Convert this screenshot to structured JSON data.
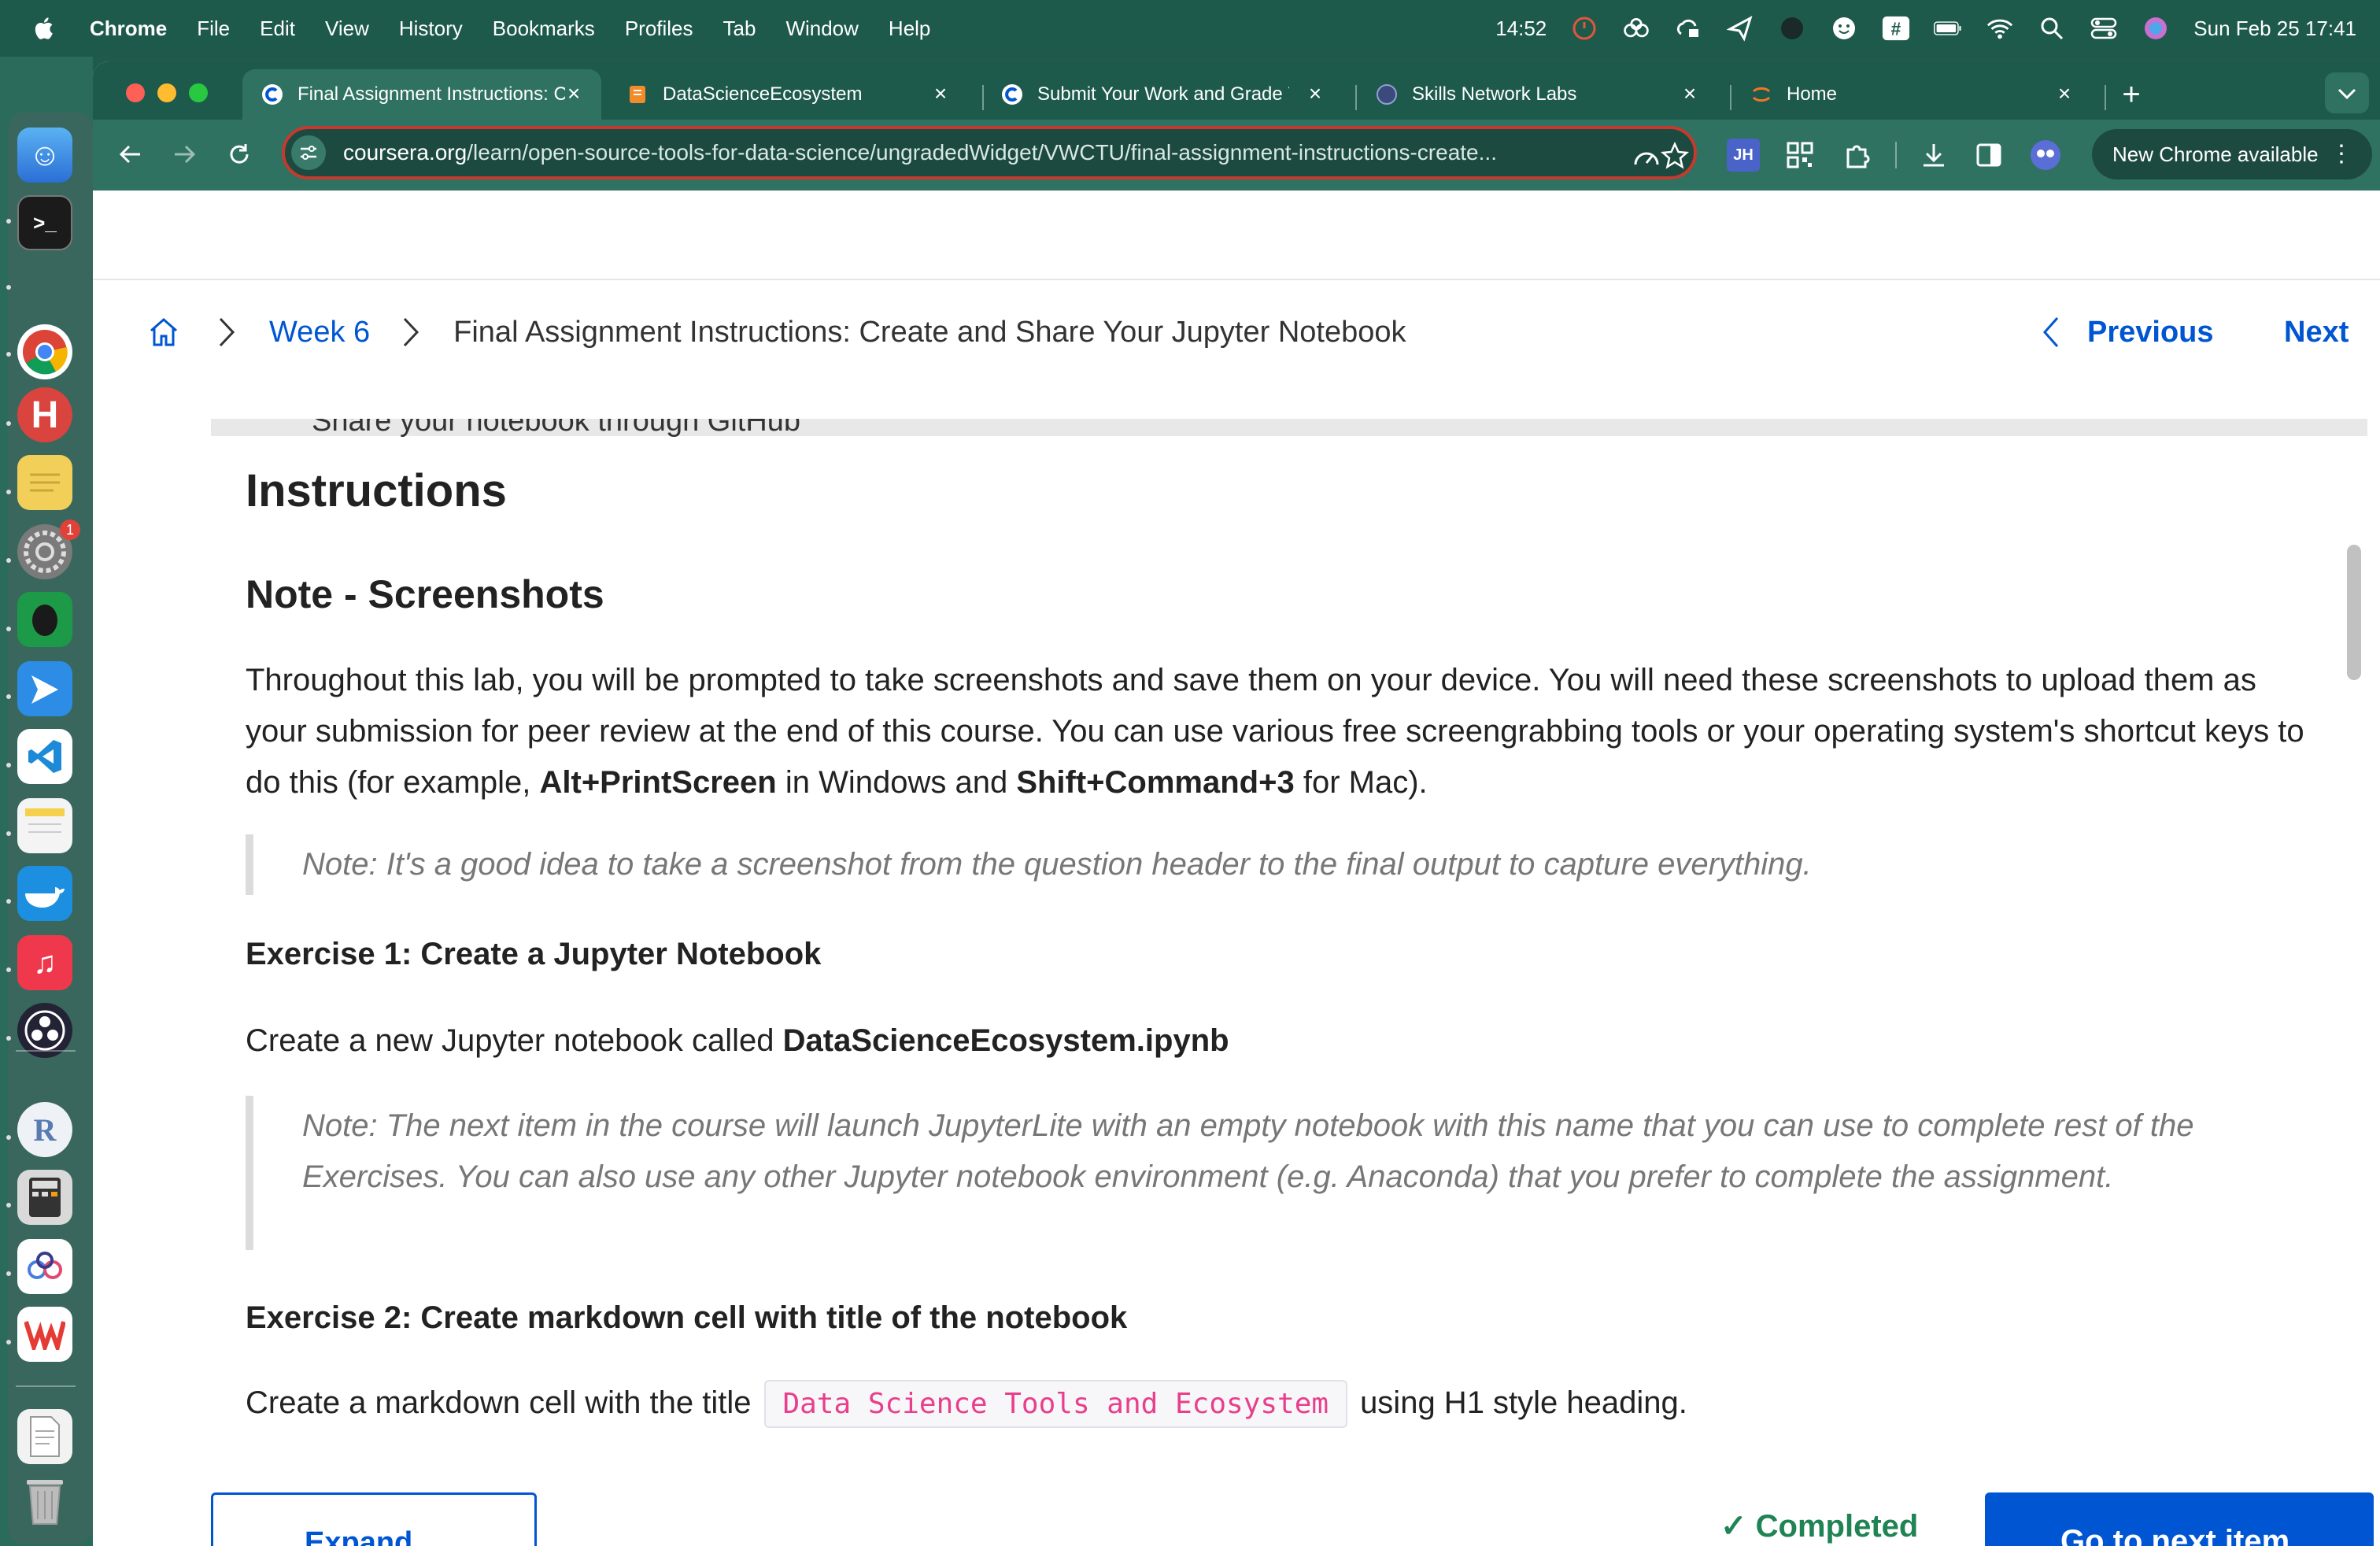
{
  "menubar": {
    "app_name": "Chrome",
    "items": [
      "File",
      "Edit",
      "View",
      "History",
      "Bookmarks",
      "Profiles",
      "Tab",
      "Window",
      "Help"
    ],
    "clock": "14:52",
    "datetime": "Sun Feb 25  17:41"
  },
  "tabs": [
    {
      "title": "Final Assignment Instructions: C",
      "favicon": "coursera-icon",
      "active": true
    },
    {
      "title": "DataScienceEcosystem",
      "favicon": "notebook-icon",
      "active": false
    },
    {
      "title": "Submit Your Work and Grade You",
      "favicon": "coursera-icon",
      "active": false
    },
    {
      "title": "Skills Network Labs",
      "favicon": "skills-network-icon",
      "active": false
    },
    {
      "title": "Home",
      "favicon": "jupyter-icon",
      "active": false
    }
  ],
  "omnibox": {
    "host": "coursera.org",
    "path": "/learn/open-source-tools-for-data-science/ungradedWidget/VWCTU/final-assignment-instructions-create..."
  },
  "toolbar": {
    "update_label": "New Chrome available",
    "extension_jh_label": "JH"
  },
  "breadcrumb": {
    "week": "Week 6",
    "current": "Final Assignment Instructions: Create and Share Your Jupyter Notebook",
    "previous": "Previous",
    "next": "Next"
  },
  "doc": {
    "cut_line": "Share your notebook through GitHub",
    "heading": "Instructions",
    "note_heading": "Note - Screenshots",
    "para1_a": "Throughout this lab, you will be prompted to take screenshots and save them on your device. You will need these screenshots to upload them as your submission for peer review at the end of this course. You can use various free screengrabbing tools or your operating system's shortcut keys to do this (for example, ",
    "para1_key1": "Alt+PrintScreen",
    "para1_b": " in Windows and ",
    "para1_key2": "Shift+Command+3",
    "para1_c": " for Mac).",
    "quote1": "Note: It's a good idea to take a screenshot from the question header to the final output to capture everything.",
    "ex1_heading": "Exercise 1: Create a Jupyter Notebook",
    "ex1_text": "Create a new Jupyter notebook called ",
    "ex1_filename": "DataScienceEcosystem.ipynb",
    "quote2": "Note: The next item in the course will launch JupyterLite with an empty notebook with this name that you can use to complete rest of the Exercises. You can also use any other Jupyter notebook environment (e.g. Anaconda) that you prefer to complete the assignment.",
    "ex2_heading": "Exercise 2: Create markdown cell with title of the notebook",
    "ex2_text_a": "Create a markdown cell with the title",
    "ex2_code": "Data Science Tools and Ecosystem",
    "ex2_text_b": "using H1 style heading."
  },
  "footer": {
    "expand_label": "Expand",
    "completed_label": "Completed",
    "goto_label": "Go to next item"
  },
  "dock": {
    "notification_badge": "1"
  },
  "colors": {
    "accent": "#0056d2",
    "chrome_frame": "#1e5a4c",
    "chrome_toolbar": "#2f7261",
    "omnibox_border": "#c43a2e",
    "code_text": "#e83e8c"
  }
}
